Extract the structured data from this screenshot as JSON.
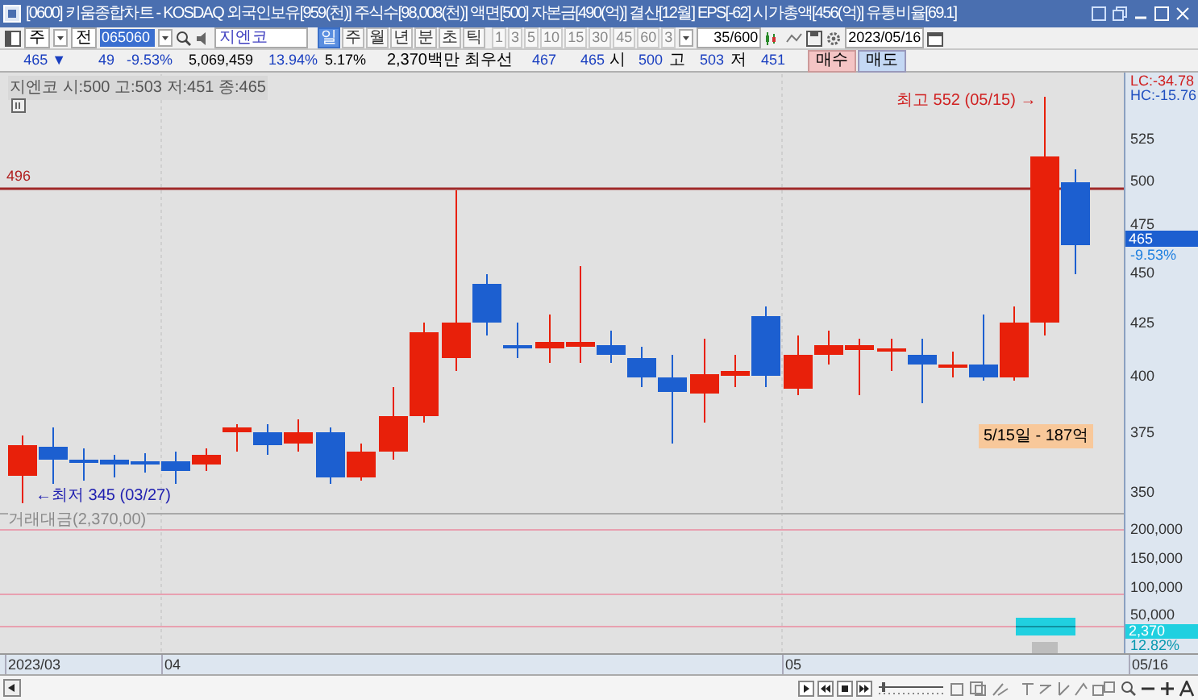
{
  "window": {
    "title": "[0600] 키움종합차트 - KOSDAQ 외국인보유[959(천)] 주식수[98,008(천)] 액면[500] 자본금[490(억)] 결산[12월] EPS[-62] 시가총액[456(억)] 유통비율[69.1]"
  },
  "toolbar": {
    "market": "주",
    "all": "전",
    "code": "065060",
    "stock_name": "지엔코",
    "periods": [
      {
        "label": "일",
        "selected": true
      },
      {
        "label": "주",
        "selected": false
      },
      {
        "label": "월",
        "selected": false
      },
      {
        "label": "년",
        "selected": false
      },
      {
        "label": "분",
        "selected": false
      },
      {
        "label": "초",
        "selected": false
      },
      {
        "label": "틱",
        "selected": false
      }
    ],
    "intervals": [
      {
        "label": "1",
        "selected": false
      },
      {
        "label": "3",
        "selected": false
      },
      {
        "label": "5",
        "selected": false
      },
      {
        "label": "10",
        "selected": false
      },
      {
        "label": "15",
        "selected": false
      },
      {
        "label": "30",
        "selected": false
      },
      {
        "label": "45",
        "selected": false
      },
      {
        "label": "60",
        "selected": false
      },
      {
        "label": "3",
        "selected": false
      }
    ],
    "count": "35/600",
    "date": "2023/05/16"
  },
  "quote": {
    "price": "465 ▼",
    "change": "49",
    "change_rate": "-9.53%",
    "volume": "5,069,459",
    "turnover": "13.94%",
    "ratio": "5.17%",
    "amount": "2,370백만",
    "best_label": "최우선",
    "best_ask": "467",
    "best_bid": "465",
    "open_label": "시",
    "open": "500",
    "high_label": "고",
    "high": "503",
    "low_label": "저",
    "low": "451",
    "buy_button": "매수",
    "sell_button": "매도"
  },
  "price_panel": {
    "legend": "지엔코 시:500 고:503 저:451 종:465",
    "line_label": "496",
    "high_note": "최고 552 (05/15) →",
    "low_note": "←최저 345 (03/27)",
    "tooltip": "5/15일 - 187억",
    "axis_top": [
      "LC:-34.78",
      "HC:-15.76"
    ],
    "axis_ticks": [
      "525",
      "500",
      "475",
      "450",
      "425",
      "400",
      "375",
      "350"
    ],
    "current_price": "465",
    "current_change": "-9.53%"
  },
  "volume_panel": {
    "legend": "거래대금(2,370,00)",
    "axis_ticks": [
      "200,000",
      "150,000",
      "100,000",
      "50,000"
    ],
    "current_value": "2,370",
    "current_rate": "12.82%"
  },
  "date_axis": [
    "2023/03",
    "04",
    "05",
    "05/16"
  ]
}
